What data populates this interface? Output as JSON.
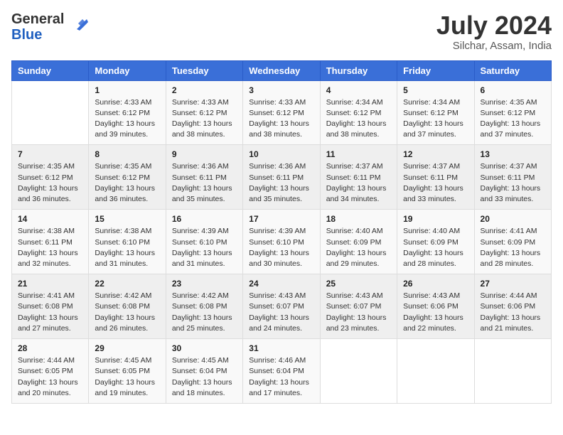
{
  "header": {
    "logo_general": "General",
    "logo_blue": "Blue",
    "month_title": "July 2024",
    "location": "Silchar, Assam, India"
  },
  "days_of_week": [
    "Sunday",
    "Monday",
    "Tuesday",
    "Wednesday",
    "Thursday",
    "Friday",
    "Saturday"
  ],
  "weeks": [
    [
      {
        "day": "",
        "info": ""
      },
      {
        "day": "1",
        "info": "Sunrise: 4:33 AM\nSunset: 6:12 PM\nDaylight: 13 hours and 39 minutes."
      },
      {
        "day": "2",
        "info": "Sunrise: 4:33 AM\nSunset: 6:12 PM\nDaylight: 13 hours and 38 minutes."
      },
      {
        "day": "3",
        "info": "Sunrise: 4:33 AM\nSunset: 6:12 PM\nDaylight: 13 hours and 38 minutes."
      },
      {
        "day": "4",
        "info": "Sunrise: 4:34 AM\nSunset: 6:12 PM\nDaylight: 13 hours and 38 minutes."
      },
      {
        "day": "5",
        "info": "Sunrise: 4:34 AM\nSunset: 6:12 PM\nDaylight: 13 hours and 37 minutes."
      },
      {
        "day": "6",
        "info": "Sunrise: 4:35 AM\nSunset: 6:12 PM\nDaylight: 13 hours and 37 minutes."
      }
    ],
    [
      {
        "day": "7",
        "info": "Sunrise: 4:35 AM\nSunset: 6:12 PM\nDaylight: 13 hours and 36 minutes."
      },
      {
        "day": "8",
        "info": "Sunrise: 4:35 AM\nSunset: 6:12 PM\nDaylight: 13 hours and 36 minutes."
      },
      {
        "day": "9",
        "info": "Sunrise: 4:36 AM\nSunset: 6:11 PM\nDaylight: 13 hours and 35 minutes."
      },
      {
        "day": "10",
        "info": "Sunrise: 4:36 AM\nSunset: 6:11 PM\nDaylight: 13 hours and 35 minutes."
      },
      {
        "day": "11",
        "info": "Sunrise: 4:37 AM\nSunset: 6:11 PM\nDaylight: 13 hours and 34 minutes."
      },
      {
        "day": "12",
        "info": "Sunrise: 4:37 AM\nSunset: 6:11 PM\nDaylight: 13 hours and 33 minutes."
      },
      {
        "day": "13",
        "info": "Sunrise: 4:37 AM\nSunset: 6:11 PM\nDaylight: 13 hours and 33 minutes."
      }
    ],
    [
      {
        "day": "14",
        "info": "Sunrise: 4:38 AM\nSunset: 6:11 PM\nDaylight: 13 hours and 32 minutes."
      },
      {
        "day": "15",
        "info": "Sunrise: 4:38 AM\nSunset: 6:10 PM\nDaylight: 13 hours and 31 minutes."
      },
      {
        "day": "16",
        "info": "Sunrise: 4:39 AM\nSunset: 6:10 PM\nDaylight: 13 hours and 31 minutes."
      },
      {
        "day": "17",
        "info": "Sunrise: 4:39 AM\nSunset: 6:10 PM\nDaylight: 13 hours and 30 minutes."
      },
      {
        "day": "18",
        "info": "Sunrise: 4:40 AM\nSunset: 6:09 PM\nDaylight: 13 hours and 29 minutes."
      },
      {
        "day": "19",
        "info": "Sunrise: 4:40 AM\nSunset: 6:09 PM\nDaylight: 13 hours and 28 minutes."
      },
      {
        "day": "20",
        "info": "Sunrise: 4:41 AM\nSunset: 6:09 PM\nDaylight: 13 hours and 28 minutes."
      }
    ],
    [
      {
        "day": "21",
        "info": "Sunrise: 4:41 AM\nSunset: 6:08 PM\nDaylight: 13 hours and 27 minutes."
      },
      {
        "day": "22",
        "info": "Sunrise: 4:42 AM\nSunset: 6:08 PM\nDaylight: 13 hours and 26 minutes."
      },
      {
        "day": "23",
        "info": "Sunrise: 4:42 AM\nSunset: 6:08 PM\nDaylight: 13 hours and 25 minutes."
      },
      {
        "day": "24",
        "info": "Sunrise: 4:43 AM\nSunset: 6:07 PM\nDaylight: 13 hours and 24 minutes."
      },
      {
        "day": "25",
        "info": "Sunrise: 4:43 AM\nSunset: 6:07 PM\nDaylight: 13 hours and 23 minutes."
      },
      {
        "day": "26",
        "info": "Sunrise: 4:43 AM\nSunset: 6:06 PM\nDaylight: 13 hours and 22 minutes."
      },
      {
        "day": "27",
        "info": "Sunrise: 4:44 AM\nSunset: 6:06 PM\nDaylight: 13 hours and 21 minutes."
      }
    ],
    [
      {
        "day": "28",
        "info": "Sunrise: 4:44 AM\nSunset: 6:05 PM\nDaylight: 13 hours and 20 minutes."
      },
      {
        "day": "29",
        "info": "Sunrise: 4:45 AM\nSunset: 6:05 PM\nDaylight: 13 hours and 19 minutes."
      },
      {
        "day": "30",
        "info": "Sunrise: 4:45 AM\nSunset: 6:04 PM\nDaylight: 13 hours and 18 minutes."
      },
      {
        "day": "31",
        "info": "Sunrise: 4:46 AM\nSunset: 6:04 PM\nDaylight: 13 hours and 17 minutes."
      },
      {
        "day": "",
        "info": ""
      },
      {
        "day": "",
        "info": ""
      },
      {
        "day": "",
        "info": ""
      }
    ]
  ]
}
